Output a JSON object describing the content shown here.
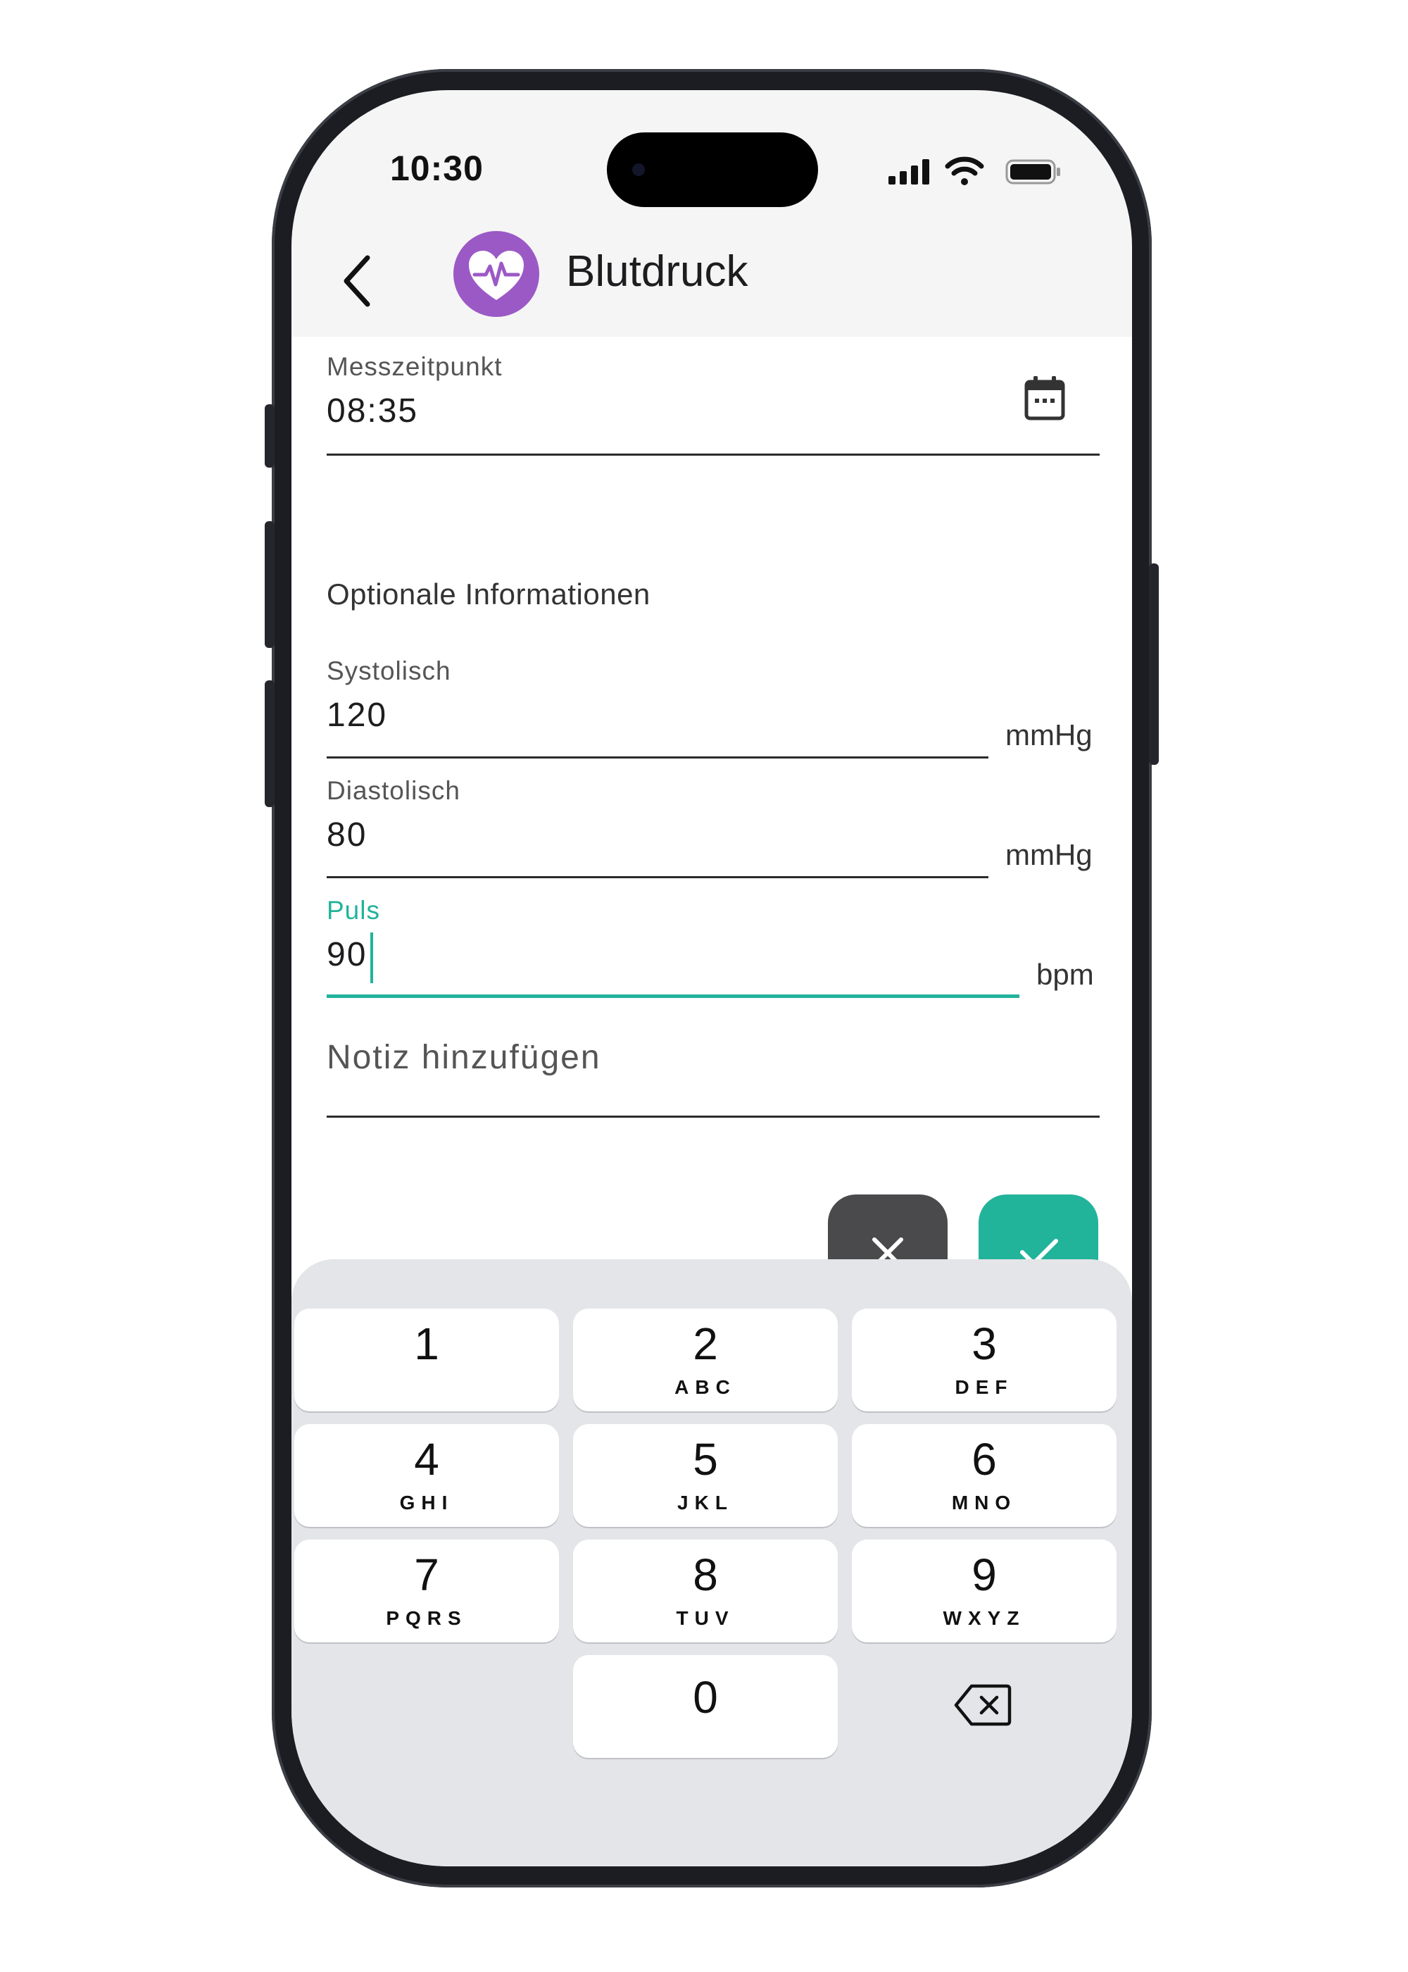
{
  "status_bar": {
    "time": "10:30"
  },
  "header": {
    "title": "Blutdruck",
    "back_icon": "chevron-left-icon",
    "logo_icon": "heart-pulse-icon"
  },
  "measurement_time": {
    "label": "Messzeitpunkt",
    "value": "08:35",
    "icon": "calendar-icon"
  },
  "optional_section": {
    "title": "Optionale Informationen"
  },
  "systolic": {
    "label": "Systolisch",
    "value": "120",
    "unit": "mmHg"
  },
  "diastolic": {
    "label": "Diastolisch",
    "value": "80",
    "unit": "mmHg"
  },
  "pulse": {
    "label": "Puls",
    "value": "90",
    "unit": "bpm"
  },
  "note": {
    "placeholder": "Notiz hinzufügen"
  },
  "actions": {
    "cancel_icon": "close-icon",
    "confirm_icon": "check-icon"
  },
  "keypad": {
    "keys": [
      {
        "num": "1",
        "letters": ""
      },
      {
        "num": "2",
        "letters": "ABC"
      },
      {
        "num": "3",
        "letters": "DEF"
      },
      {
        "num": "4",
        "letters": "GHI"
      },
      {
        "num": "5",
        "letters": "JKL"
      },
      {
        "num": "6",
        "letters": "MNO"
      },
      {
        "num": "7",
        "letters": "PQRS"
      },
      {
        "num": "8",
        "letters": "TUV"
      },
      {
        "num": "9",
        "letters": "WXYZ"
      },
      {
        "num": "0",
        "letters": ""
      }
    ],
    "delete_icon": "backspace-icon"
  },
  "colors": {
    "accent": "#22b39b",
    "logo": "#9b59c6",
    "cancel": "#4a4a4c"
  }
}
